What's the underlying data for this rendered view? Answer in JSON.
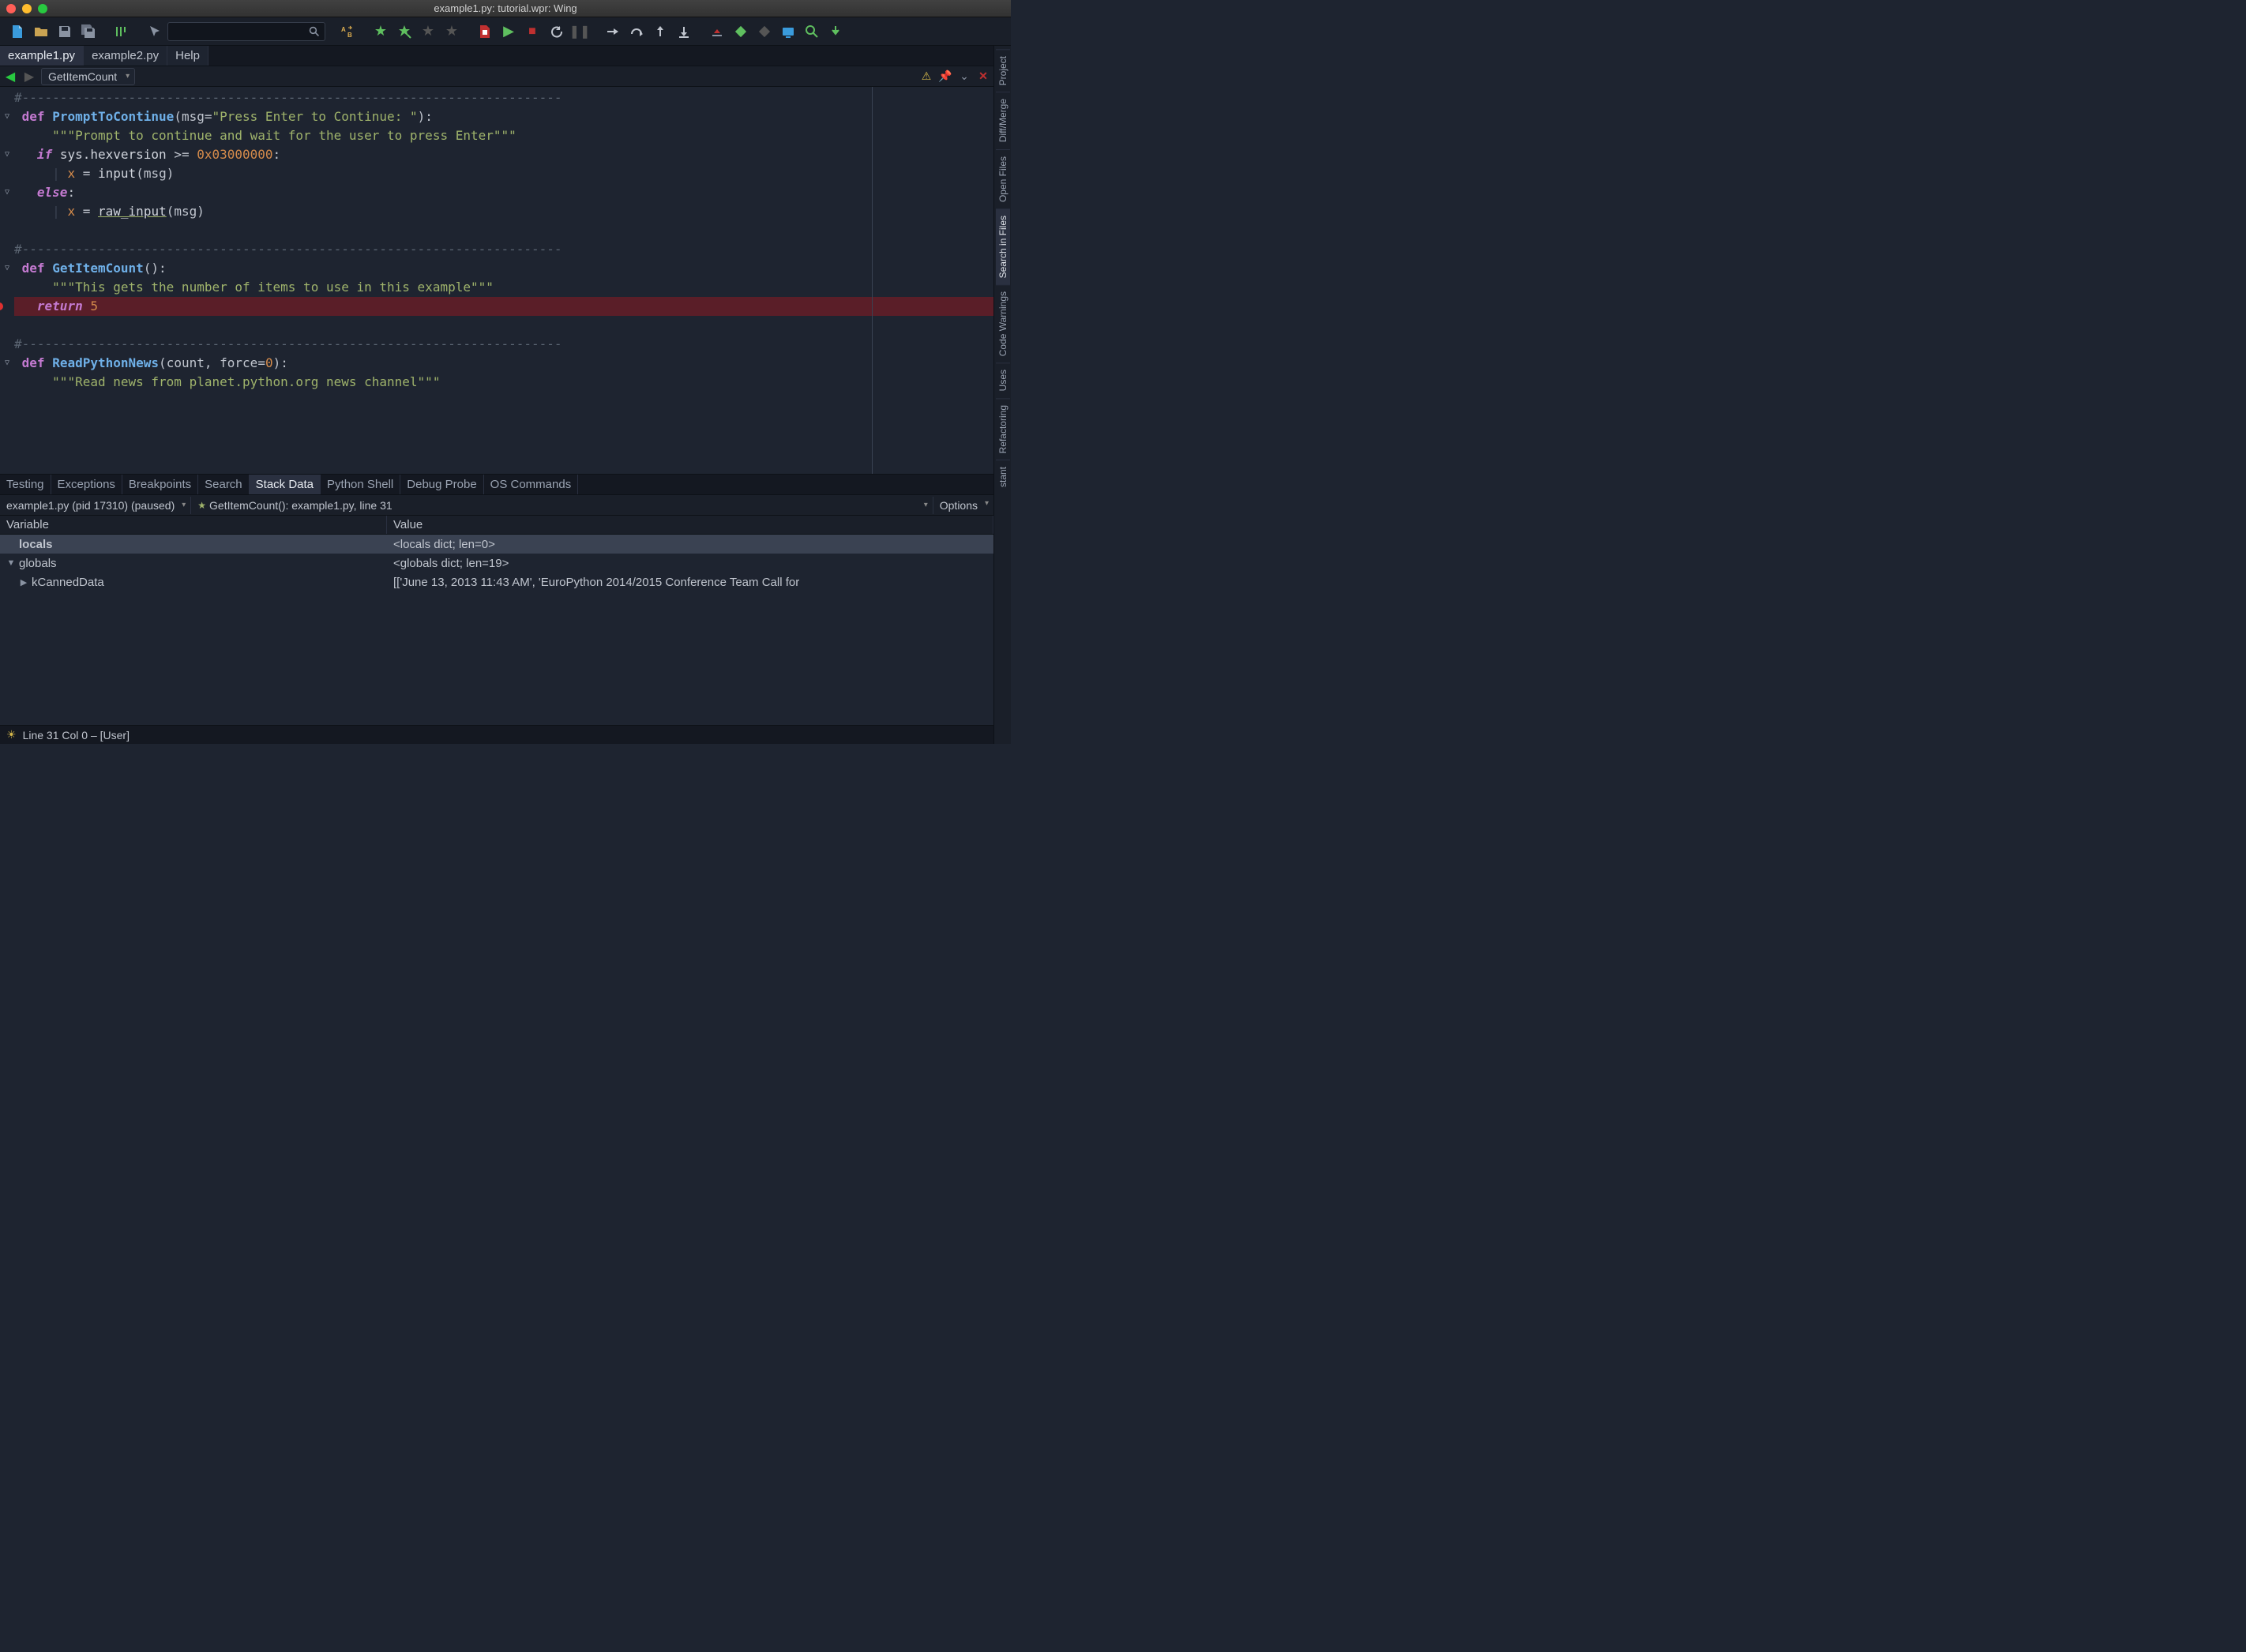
{
  "window": {
    "title": "example1.py: tutorial.wpr: Wing"
  },
  "editor_tabs": [
    {
      "label": "example1.py",
      "active": true
    },
    {
      "label": "example2.py",
      "active": false
    },
    {
      "label": "Help",
      "active": false
    }
  ],
  "symbol_nav": {
    "current": "GetItemCount"
  },
  "code_lines": [
    {
      "type": "cmt",
      "text": "#-----------------------------------------------------------------------"
    },
    {
      "type": "def",
      "fn": "PromptToContinue",
      "params": "msg=\"Press Enter to Continue: \"",
      "fold": true
    },
    {
      "type": "doc",
      "text": "    \"\"\"Prompt to continue and wait for the user to press Enter\"\"\""
    },
    {
      "type": "if",
      "cond": "sys.hexversion >= 0x03000000",
      "fold": true
    },
    {
      "type": "assign",
      "text": "      x = input(msg)"
    },
    {
      "type": "else",
      "fold": true
    },
    {
      "type": "assign_raw",
      "text": "      x = raw_input(msg)"
    },
    {
      "type": "blank"
    },
    {
      "type": "cmt",
      "text": "#-----------------------------------------------------------------------"
    },
    {
      "type": "def",
      "fn": "GetItemCount",
      "params": "",
      "fold": true
    },
    {
      "type": "doc",
      "text": "    \"\"\"This gets the number of items to use in this example\"\"\""
    },
    {
      "type": "return",
      "val": "5",
      "hl": true,
      "bp": true
    },
    {
      "type": "blank"
    },
    {
      "type": "cmt",
      "text": "#-----------------------------------------------------------------------"
    },
    {
      "type": "def",
      "fn": "ReadPythonNews",
      "params": "count, force=0",
      "fold": true
    },
    {
      "type": "doc",
      "text": "    \"\"\"Read news from planet.python.org news channel\"\"\""
    },
    {
      "type": "blank"
    }
  ],
  "right_tabs": [
    "Project",
    "Diff/Merge",
    "Open Files",
    "Search in Files",
    "Code Warnings",
    "Uses",
    "Refactoring",
    "stant"
  ],
  "right_tab_active": "Search in Files",
  "panel_tabs": [
    "Testing",
    "Exceptions",
    "Breakpoints",
    "Search",
    "Stack Data",
    "Python Shell",
    "Debug Probe",
    "OS Commands"
  ],
  "panel_tab_active": "Stack Data",
  "panel_head": {
    "process": "example1.py (pid 17310) (paused)",
    "frame": "GetItemCount(): example1.py, line 31",
    "options": "Options"
  },
  "columns": {
    "variable": "Variable",
    "value": "Value"
  },
  "rows": [
    {
      "k": "locals",
      "v": "<locals dict; len=0>",
      "sel": true,
      "bold": true,
      "indent": 0,
      "arrow": ""
    },
    {
      "k": "globals",
      "v": "<globals dict; len=19>",
      "sel": false,
      "bold": false,
      "indent": 0,
      "arrow": "▼"
    },
    {
      "k": "kCannedData",
      "v": "[['June 13, 2013 11:43 AM', 'EuroPython 2014/2015 Conference Team Call for",
      "sel": false,
      "bold": false,
      "indent": 1,
      "arrow": "▶"
    }
  ],
  "status": {
    "text": "Line 31 Col 0 – [User]"
  }
}
